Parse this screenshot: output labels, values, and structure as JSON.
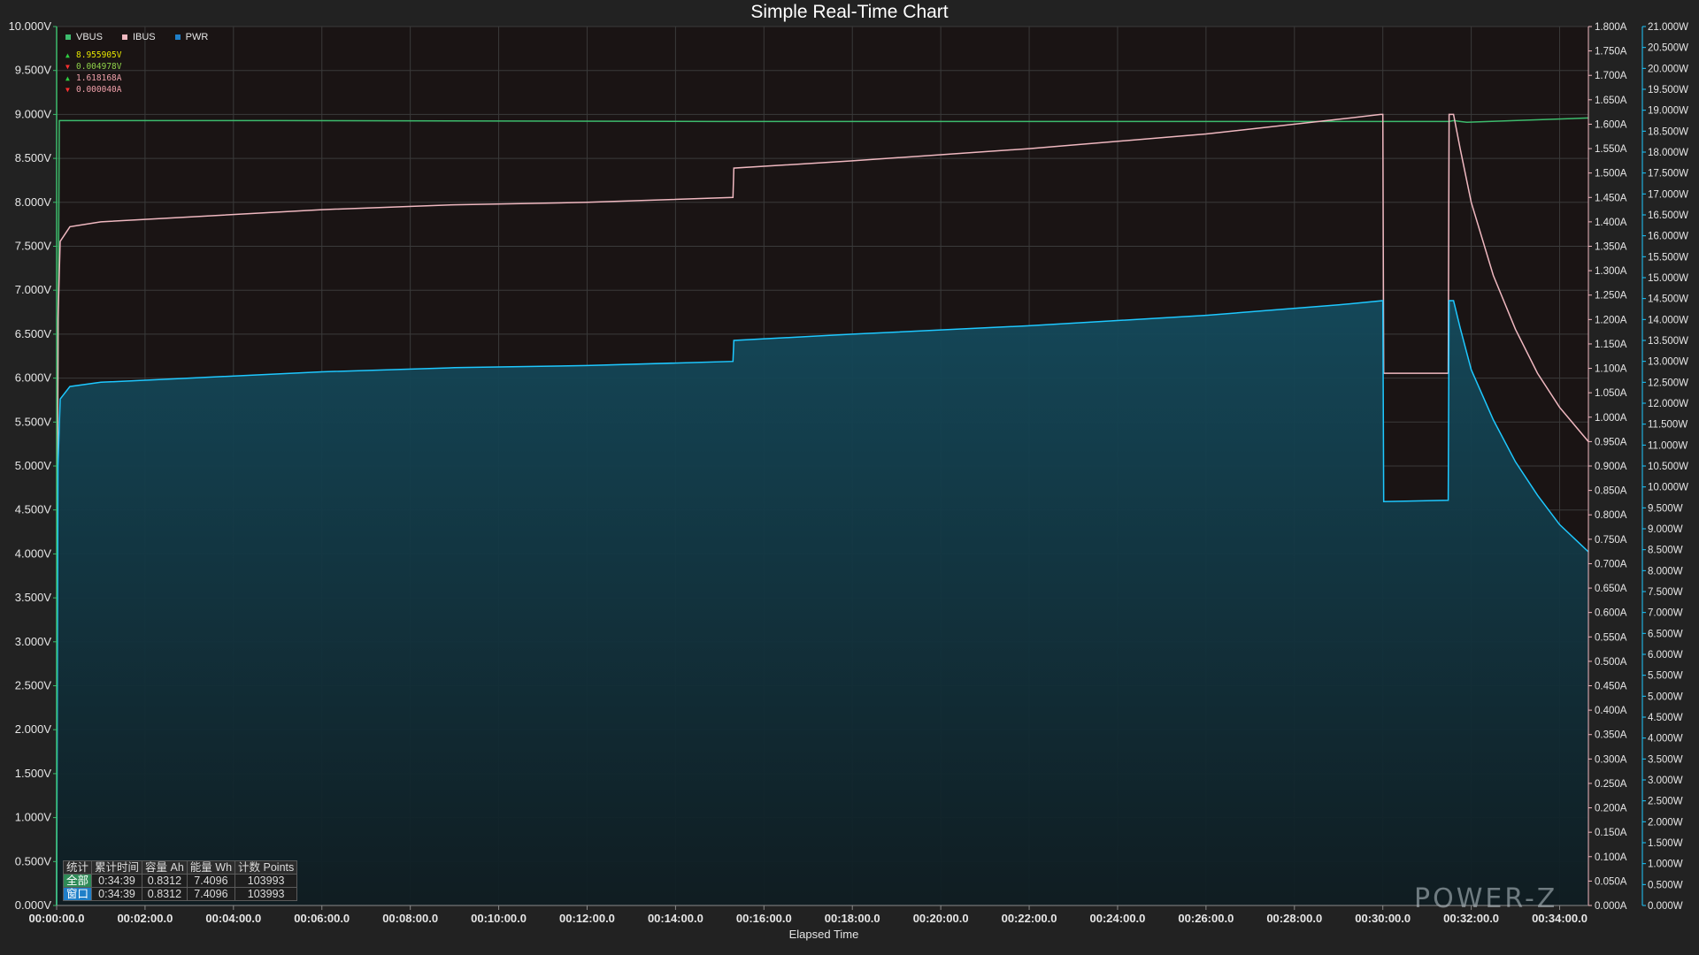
{
  "title": "Simple Real-Time Chart",
  "legend": [
    {
      "name": "VBUS",
      "color": "#3dbb6d"
    },
    {
      "name": "IBUS",
      "color": "#f0b8c0"
    },
    {
      "name": "PWR",
      "color": "#1f7fc8"
    }
  ],
  "readouts": [
    {
      "dir": "up",
      "text": "8.955905V",
      "color": "#e6e600"
    },
    {
      "dir": "down",
      "text": "0.004978V",
      "color": "#8fd24a"
    },
    {
      "dir": "up",
      "text": "1.618168A",
      "color": "#f0a0aa"
    },
    {
      "dir": "down",
      "text": "0.000040A",
      "color": "#f0a0aa"
    }
  ],
  "stats": {
    "headers": [
      "统计",
      "累计时间",
      "容量 Ah",
      "能量 Wh",
      "计数 Points"
    ],
    "rows": [
      {
        "label": "全部",
        "time": "0:34:39",
        "ah": "0.8312",
        "wh": "7.4096",
        "points": "103993"
      },
      {
        "label": "窗口",
        "time": "0:34:39",
        "ah": "0.8312",
        "wh": "7.4096",
        "points": "103993"
      }
    ]
  },
  "watermark": "POWER-Z",
  "chart_data": {
    "type": "line",
    "title": "Simple Real-Time Chart",
    "xlabel": "Elapsed Time",
    "x_unit": "minutes",
    "xlim": [
      0,
      34.65
    ],
    "x_ticks": [
      "00:00:00.0",
      "00:02:00.0",
      "00:04:00.0",
      "00:06:00.0",
      "00:08:00.0",
      "00:10:00.0",
      "00:12:00.0",
      "00:14:00.0",
      "00:16:00.0",
      "00:18:00.0",
      "00:20:00.0",
      "00:22:00.0",
      "00:24:00.0",
      "00:26:00.0",
      "00:28:00.0",
      "00:30:00.0",
      "00:32:00.0",
      "00:34:00.0"
    ],
    "y_left": {
      "label": "",
      "unit": "V",
      "lim": [
        0,
        10
      ],
      "step": 0.5
    },
    "y_right1": {
      "label": "",
      "unit": "A",
      "lim": [
        0,
        1.8
      ],
      "step": 0.05
    },
    "y_right2": {
      "label": "",
      "unit": "W",
      "lim": [
        0,
        21
      ],
      "step": 0.5
    },
    "grid": true,
    "legend_position": "top-left",
    "series": [
      {
        "name": "VBUS",
        "axis": "V",
        "color": "#3dbb6d",
        "points": [
          [
            0,
            0
          ],
          [
            0.02,
            5.1
          ],
          [
            0.06,
            8.93
          ],
          [
            5,
            8.93
          ],
          [
            15,
            8.92
          ],
          [
            25,
            8.92
          ],
          [
            30,
            8.92
          ],
          [
            31.5,
            8.92
          ],
          [
            31.6,
            8.93
          ],
          [
            31.9,
            8.91
          ],
          [
            34.65,
            8.96
          ]
        ]
      },
      {
        "name": "IBUS",
        "axis": "A",
        "color": "#f0b8c0",
        "points": [
          [
            0,
            0
          ],
          [
            0.03,
            1.2
          ],
          [
            0.08,
            1.36
          ],
          [
            0.3,
            1.39
          ],
          [
            1,
            1.4
          ],
          [
            3,
            1.41
          ],
          [
            6,
            1.425
          ],
          [
            9,
            1.435
          ],
          [
            12,
            1.44
          ],
          [
            15.3,
            1.45
          ],
          [
            15.32,
            1.51
          ],
          [
            18,
            1.525
          ],
          [
            22,
            1.55
          ],
          [
            26,
            1.58
          ],
          [
            29,
            1.61
          ],
          [
            29.95,
            1.62
          ],
          [
            30,
            1.62
          ],
          [
            30.02,
            1.09
          ],
          [
            31.48,
            1.09
          ],
          [
            31.5,
            1.62
          ],
          [
            31.6,
            1.62
          ],
          [
            31.75,
            1.55
          ],
          [
            32,
            1.44
          ],
          [
            32.5,
            1.29
          ],
          [
            33,
            1.18
          ],
          [
            33.5,
            1.09
          ],
          [
            34,
            1.02
          ],
          [
            34.65,
            0.95
          ]
        ]
      },
      {
        "name": "PWR",
        "axis": "W",
        "color": "#1f7fc8",
        "fill": true,
        "points": [
          [
            0,
            0
          ],
          [
            0.03,
            10.5
          ],
          [
            0.08,
            12.1
          ],
          [
            0.3,
            12.4
          ],
          [
            1,
            12.5
          ],
          [
            3,
            12.6
          ],
          [
            6,
            12.75
          ],
          [
            9,
            12.85
          ],
          [
            12,
            12.9
          ],
          [
            15.3,
            13.0
          ],
          [
            15.32,
            13.5
          ],
          [
            18,
            13.65
          ],
          [
            22,
            13.85
          ],
          [
            26,
            14.1
          ],
          [
            29,
            14.35
          ],
          [
            30,
            14.45
          ],
          [
            30.02,
            9.65
          ],
          [
            31.48,
            9.68
          ],
          [
            31.5,
            14.45
          ],
          [
            31.6,
            14.45
          ],
          [
            31.75,
            13.8
          ],
          [
            32,
            12.8
          ],
          [
            32.5,
            11.6
          ],
          [
            33,
            10.6
          ],
          [
            33.5,
            9.8
          ],
          [
            34,
            9.1
          ],
          [
            34.65,
            8.45
          ]
        ]
      }
    ]
  }
}
